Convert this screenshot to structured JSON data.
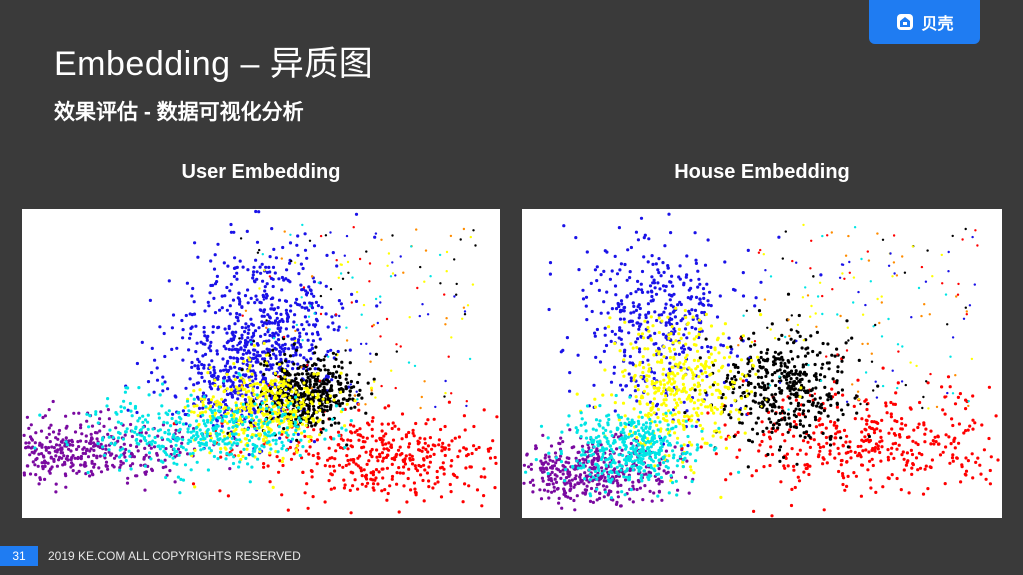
{
  "slide": {
    "title": "Embedding – 异质图",
    "subtitle": "效果评估 - 数据可视化分析",
    "logo_text": "贝壳",
    "page_number": "31",
    "footer": "2019 KE.COM ALL COPYRIGHTS RESERVED"
  },
  "plots": {
    "left_label": "User Embedding",
    "right_label": "House Embedding"
  },
  "colors": {
    "background": "#3a3a3a",
    "accent": "#1f7cf2",
    "clusters": [
      "#1a12e8",
      "#00e5e5",
      "#ffff00",
      "#ff0000",
      "#000000",
      "#7a0aa0",
      "#ff8c00"
    ]
  },
  "chart_data": [
    {
      "type": "scatter",
      "title": "User Embedding",
      "series": [
        {
          "color": "#1a12e8",
          "points": [
            [
              0.52,
              0.35
            ],
            [
              0.45,
              0.55
            ]
          ]
        },
        {
          "color": "#7a0aa0",
          "points": [
            [
              0.12,
              0.78
            ]
          ]
        },
        {
          "color": "#ff0000",
          "points": [
            [
              0.75,
              0.8
            ]
          ]
        },
        {
          "color": "#000000",
          "points": [
            [
              0.6,
              0.6
            ]
          ]
        },
        {
          "color": "#ffff00",
          "points": [
            [
              0.5,
              0.65
            ]
          ]
        },
        {
          "color": "#00e5e5",
          "points": [
            [
              0.38,
              0.72
            ]
          ]
        }
      ]
    },
    {
      "type": "scatter",
      "title": "House Embedding",
      "series": [
        {
          "color": "#1a12e8",
          "points": [
            [
              0.28,
              0.35
            ]
          ]
        },
        {
          "color": "#7a0aa0",
          "points": [
            [
              0.15,
              0.85
            ]
          ]
        },
        {
          "color": "#ff0000",
          "points": [
            [
              0.72,
              0.75
            ]
          ]
        },
        {
          "color": "#000000",
          "points": [
            [
              0.55,
              0.58
            ]
          ]
        },
        {
          "color": "#ffff00",
          "points": [
            [
              0.33,
              0.57
            ]
          ]
        },
        {
          "color": "#00e5e5",
          "points": [
            [
              0.22,
              0.78
            ]
          ]
        }
      ]
    }
  ]
}
